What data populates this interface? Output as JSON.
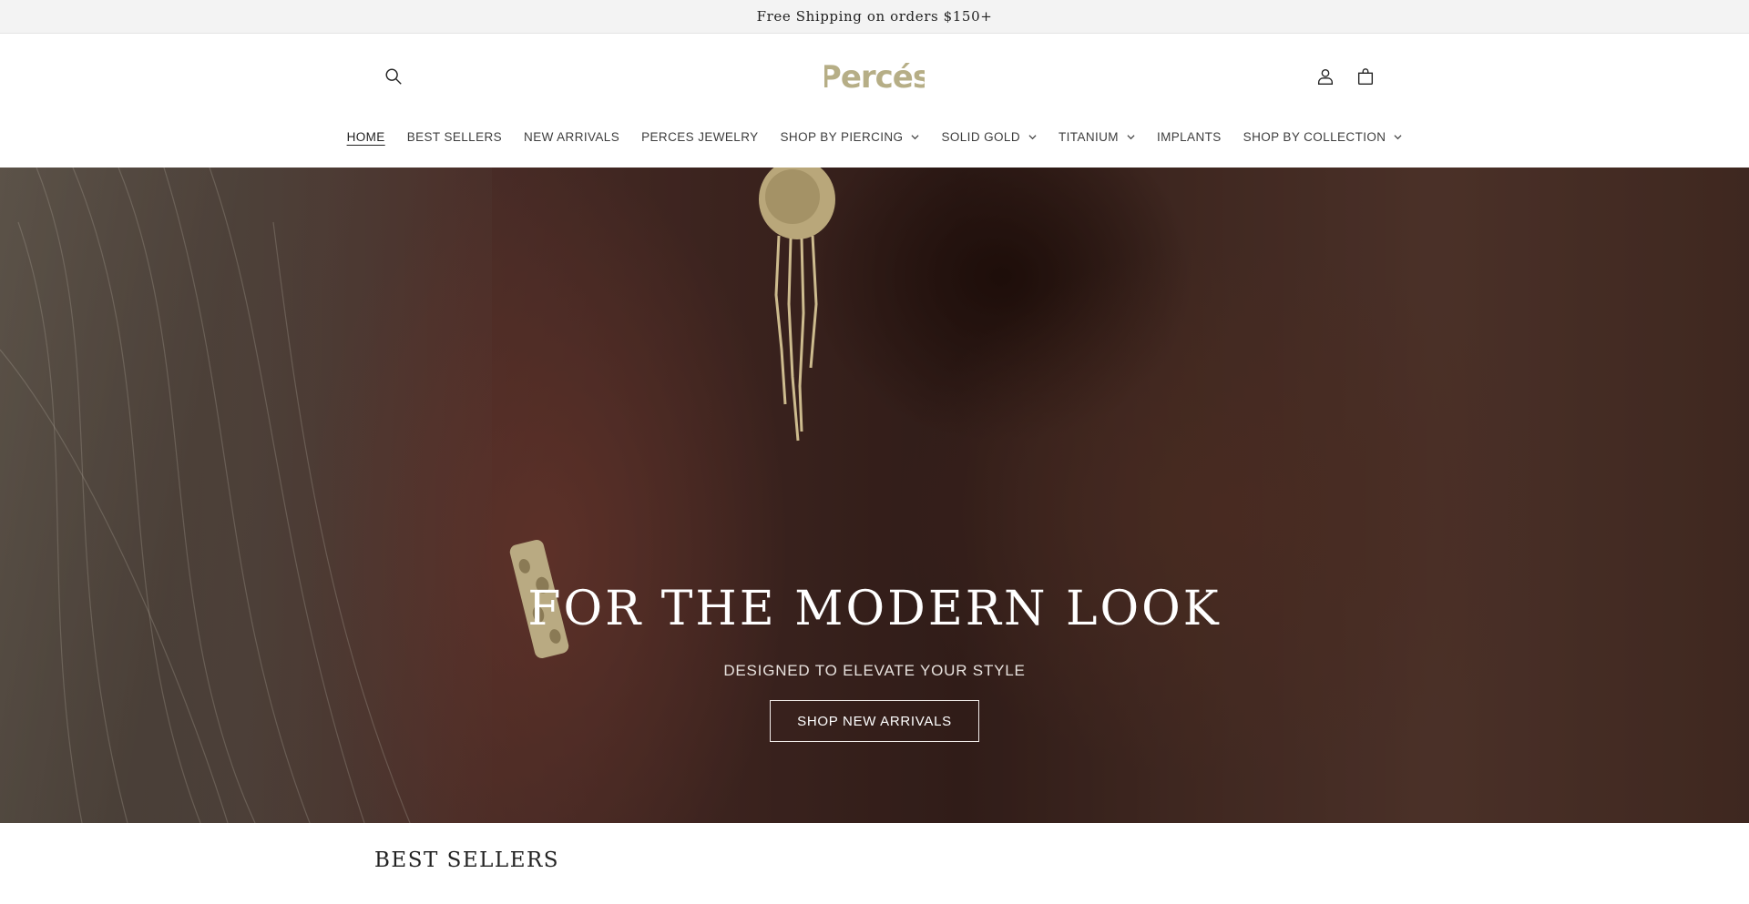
{
  "announcement": {
    "text": "Free Shipping on orders $150+"
  },
  "header": {
    "logo_text": "Percés",
    "icons": {
      "search": "search-icon",
      "account": "account-icon",
      "cart": "cart-icon"
    },
    "brand_color": "#b6ae86"
  },
  "nav": {
    "items": [
      {
        "label": "HOME",
        "active": true,
        "dropdown": false
      },
      {
        "label": "BEST SELLERS",
        "active": false,
        "dropdown": false
      },
      {
        "label": "NEW ARRIVALS",
        "active": false,
        "dropdown": false
      },
      {
        "label": "PERCES JEWELRY",
        "active": false,
        "dropdown": false
      },
      {
        "label": "SHOP BY PIERCING",
        "active": false,
        "dropdown": true
      },
      {
        "label": "SOLID GOLD",
        "active": false,
        "dropdown": true
      },
      {
        "label": "TITANIUM",
        "active": false,
        "dropdown": true
      },
      {
        "label": "IMPLANTS",
        "active": false,
        "dropdown": false
      },
      {
        "label": "SHOP BY COLLECTION",
        "active": false,
        "dropdown": true
      }
    ]
  },
  "hero": {
    "title": "FOR THE MODERN LOOK",
    "subtitle": "DESIGNED TO ELEVATE YOUR STYLE",
    "button_label": "SHOP NEW ARRIVALS"
  },
  "best_sellers": {
    "title": "BEST SELLERS"
  }
}
